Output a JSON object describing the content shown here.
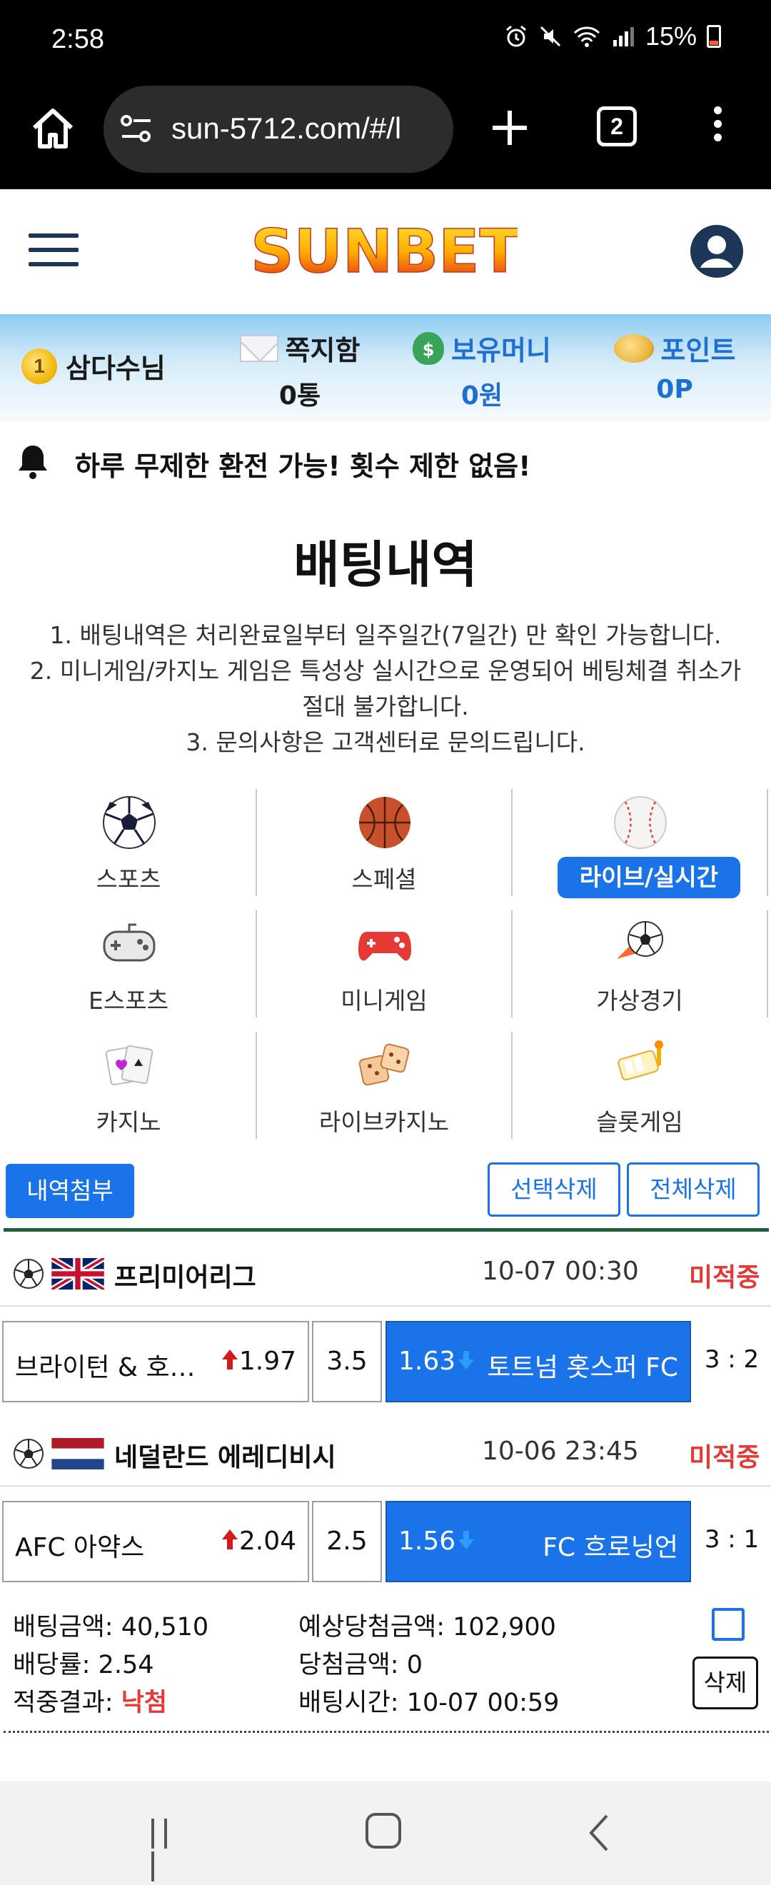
{
  "status": {
    "time": "2:58",
    "battery": "15%"
  },
  "browser": {
    "url": "sun-5712.com/#/l",
    "tab_count": "2"
  },
  "site": {
    "logo_text": "SUNBET"
  },
  "user": {
    "level": "1",
    "name": "삼다수님",
    "messages_label": "쪽지함",
    "messages_value": "0통",
    "money_label": "보유머니",
    "money_value": "0원",
    "points_label": "포인트",
    "points_value": "0P"
  },
  "notice": "하루 무제한 환전 가능! 횟수 제한 없음!",
  "page_title": "배팅내역",
  "rules": [
    "1. 배팅내역은 처리완료일부터 일주일간(7일간) 만 확인 가능합니다.",
    "2. 미니게임/카지노 게임은 특성상 실시간으로 운영되어 베팅체결 취소가 절대 불가합니다.",
    "3. 문의사항은 고객센터로 문의드립니다."
  ],
  "categories": [
    {
      "label": "스포츠",
      "icon": "soccer-ball-icon"
    },
    {
      "label": "스페셜",
      "icon": "basketball-icon"
    },
    {
      "label": "라이브/실시간",
      "icon": "baseball-icon",
      "active": true
    },
    {
      "label": "E스포츠",
      "icon": "gamepad-icon"
    },
    {
      "label": "미니게임",
      "icon": "red-controller-icon"
    },
    {
      "label": "가상경기",
      "icon": "virtual-soccer-icon"
    },
    {
      "label": "카지노",
      "icon": "cards-icon"
    },
    {
      "label": "라이브카지노",
      "icon": "dice-icon"
    },
    {
      "label": "슬롯게임",
      "icon": "slot-icon"
    }
  ],
  "actions": {
    "attach": "내역첨부",
    "delete_selected": "선택삭제",
    "delete_all": "전체삭제"
  },
  "bets": [
    {
      "league": "프리미어리그",
      "flag": "uk",
      "datetime": "10-07 00:30",
      "status": "미적중",
      "home": "브라이턴 & 호…",
      "home_odds": "1.97",
      "handicap": "3.5",
      "away_odds": "1.63",
      "away": "토트넘 홋스퍼 FC",
      "score": "3 : 2"
    },
    {
      "league": "네덜란드 에레디비시",
      "flag": "nl",
      "datetime": "10-06 23:45",
      "status": "미적중",
      "home": "AFC 아약스",
      "home_odds": "2.04",
      "handicap": "2.5",
      "away_odds": "1.56",
      "away": "FC 흐로닝언",
      "score": "3 : 1"
    }
  ],
  "summary": {
    "bet_amount_label": "배팅금액:",
    "bet_amount": "40,510",
    "odds_label": "배당률:",
    "odds": "2.54",
    "result_label": "적중결과:",
    "result": "낙첨",
    "expected_label": "예상당첨금액:",
    "expected": "102,900",
    "win_label": "당첨금액:",
    "win": "0",
    "time_label": "배팅시간:",
    "time": "10-07 00:59",
    "delete": "삭제"
  },
  "colors": {
    "primary": "#1a73e8",
    "red": "#e53935",
    "divider": "#1e5e3a"
  }
}
